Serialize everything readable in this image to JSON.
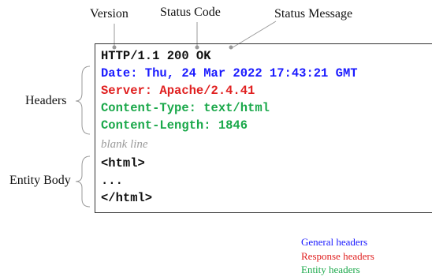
{
  "labels": {
    "version": "Version",
    "status_code": "Status Code",
    "status_message": "Status Message",
    "headers": "Headers",
    "entity_body": "Entity Body"
  },
  "message": {
    "status_line": "HTTP/1.1 200 OK",
    "date": "Date: Thu, 24 Mar 2022 17:43:21 GMT",
    "server": "Server: Apache/2.4.41",
    "content_type": "Content-Type: text/html",
    "content_length": "Content-Length: 1846",
    "blank_line": "blank line",
    "body_open": "<html>",
    "body_ellipsis": "...",
    "body_close": "</html>"
  },
  "legend": {
    "general": "General headers",
    "response": "Response headers",
    "entity": "Entity headers"
  },
  "colors": {
    "general": "#1a1aff",
    "response": "#e02020",
    "entity": "#1aa84a",
    "text": "#111111",
    "muted": "#9a9a9a"
  }
}
